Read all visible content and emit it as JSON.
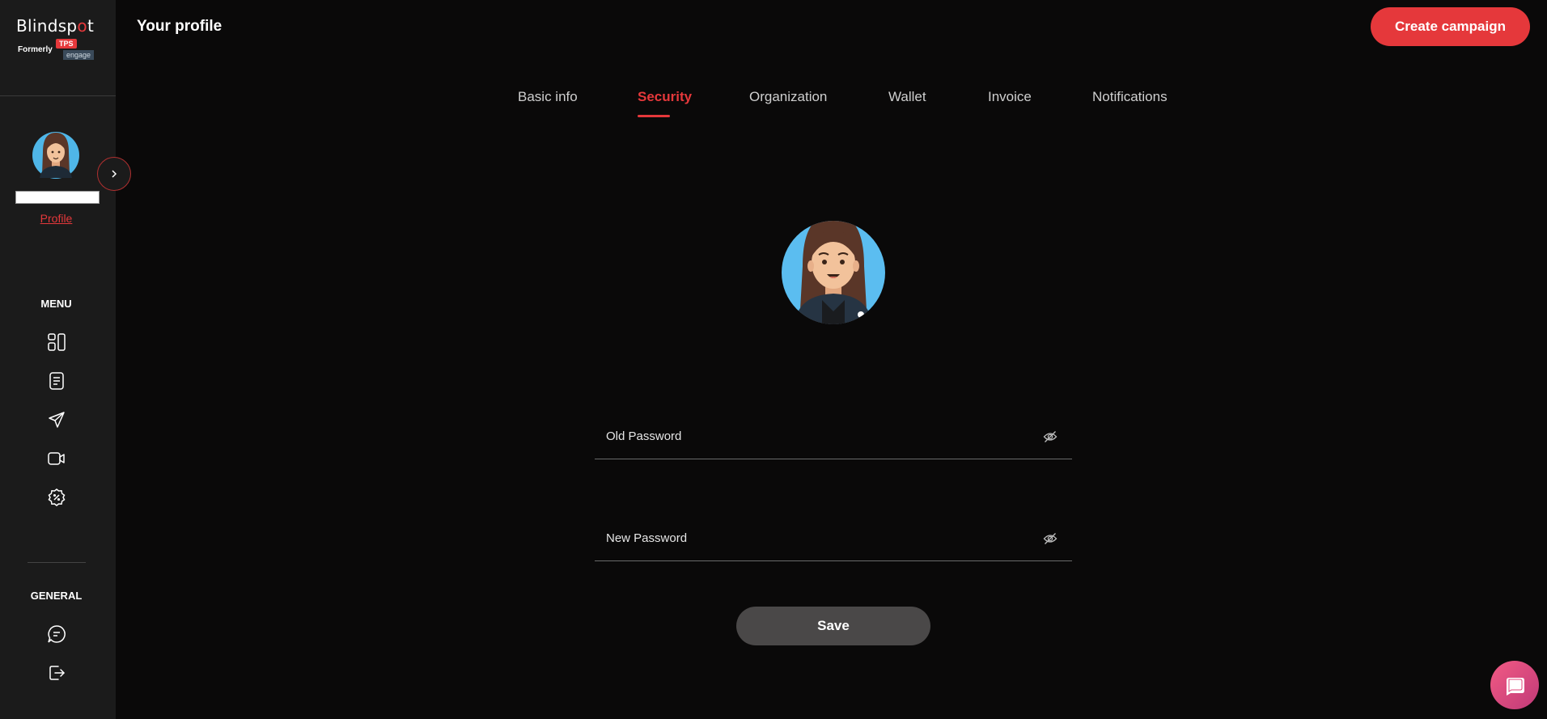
{
  "brand": {
    "name_part1": "Blindsp",
    "name_dot": "o",
    "name_part2": "t",
    "formerly": "Formerly",
    "tps": "TPS",
    "engage": "engage"
  },
  "sidebar": {
    "profile_link": "Profile",
    "menu_label": "MENU",
    "general_label": "GENERAL",
    "menu_icons": [
      "dashboard-icon",
      "document-icon",
      "send-icon",
      "video-icon",
      "discount-icon"
    ],
    "general_icons": [
      "chat-icon",
      "logout-icon"
    ]
  },
  "header": {
    "title": "Your profile",
    "create_button": "Create campaign"
  },
  "tabs": [
    {
      "label": "Basic info",
      "active": false
    },
    {
      "label": "Security",
      "active": true
    },
    {
      "label": "Organization",
      "active": false
    },
    {
      "label": "Wallet",
      "active": false
    },
    {
      "label": "Invoice",
      "active": false
    },
    {
      "label": "Notifications",
      "active": false
    }
  ],
  "form": {
    "old_password_label": "Old Password",
    "new_password_label": "New Password",
    "save_label": "Save"
  },
  "colors": {
    "accent": "#e5383b",
    "background": "#0a0909",
    "sidebar": "#1b1b1b",
    "save_button": "#4a4848",
    "chat_button": "#e0477c"
  }
}
